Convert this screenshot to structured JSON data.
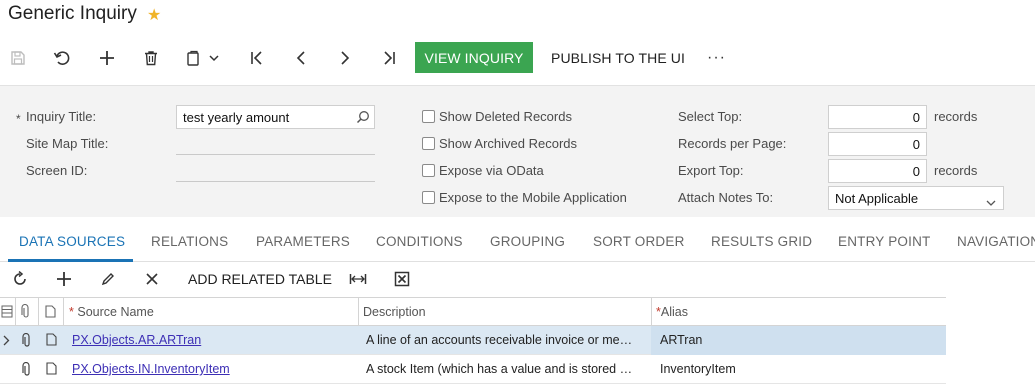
{
  "header": {
    "title": "Generic Inquiry",
    "star": "★"
  },
  "toolbar": {
    "view_inquiry": "VIEW INQUIRY",
    "publish": "PUBLISH TO THE UI",
    "more": "···"
  },
  "form": {
    "inquiry_title_label": "Inquiry Title:",
    "inquiry_title_value": "test yearly amount",
    "sitemap_title_label": "Site Map Title:",
    "screen_id_label": "Screen ID:",
    "show_deleted": "Show Deleted Records",
    "show_archived": "Show Archived Records",
    "expose_odata": "Expose via OData",
    "expose_mobile": "Expose to the Mobile Application",
    "select_top_label": "Select Top:",
    "select_top_value": "0",
    "select_top_unit": "records",
    "records_per_page_label": "Records per Page:",
    "records_per_page_value": "0",
    "export_top_label": "Export Top:",
    "export_top_value": "0",
    "export_top_unit": "records",
    "attach_notes_label": "Attach Notes To:",
    "attach_notes_value": "Not Applicable"
  },
  "tabs": [
    "DATA SOURCES",
    "RELATIONS",
    "PARAMETERS",
    "CONDITIONS",
    "GROUPING",
    "SORT ORDER",
    "RESULTS GRID",
    "ENTRY POINT",
    "NAVIGATION"
  ],
  "grid_toolbar": {
    "add_related": "ADD RELATED TABLE"
  },
  "grid": {
    "columns": {
      "source_name": "Source Name",
      "description": "Description",
      "alias": "Alias"
    },
    "rows": [
      {
        "source": "PX.Objects.AR.ARTran",
        "description": "A line of an accounts receivable invoice or me…",
        "alias": "ARTran"
      },
      {
        "source": "PX.Objects.IN.InventoryItem",
        "description": "A stock Item (which has a value and is stored …",
        "alias": "InventoryItem"
      }
    ]
  },
  "colors": {
    "accent_blue": "#1a73b5",
    "green_button": "#3ba551",
    "star": "#f0b429",
    "selected_row": "#dbe8f3"
  }
}
